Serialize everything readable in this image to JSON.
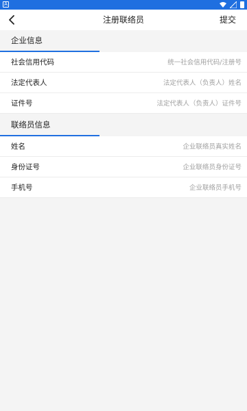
{
  "statusbar": {
    "left_icon": "A"
  },
  "header": {
    "title": "注册联络员",
    "submit_label": "提交"
  },
  "sections": [
    {
      "title": "企业信息",
      "fields": [
        {
          "label": "社会信用代码",
          "placeholder": "统一社会信用代码/注册号"
        },
        {
          "label": "法定代表人",
          "placeholder": "法定代表人（负责人）姓名"
        },
        {
          "label": "证件号",
          "placeholder": "法定代表人（负责人）证件号"
        }
      ]
    },
    {
      "title": "联络员信息",
      "fields": [
        {
          "label": "姓名",
          "placeholder": "企业联络员真实姓名"
        },
        {
          "label": "身份证号",
          "placeholder": "企业联络员身份证号"
        },
        {
          "label": "手机号",
          "placeholder": "企业联络员手机号"
        }
      ]
    }
  ],
  "colors": {
    "accent": "#1f6fe0",
    "background": "#f4f4f4",
    "placeholder": "#a0a0a0"
  }
}
